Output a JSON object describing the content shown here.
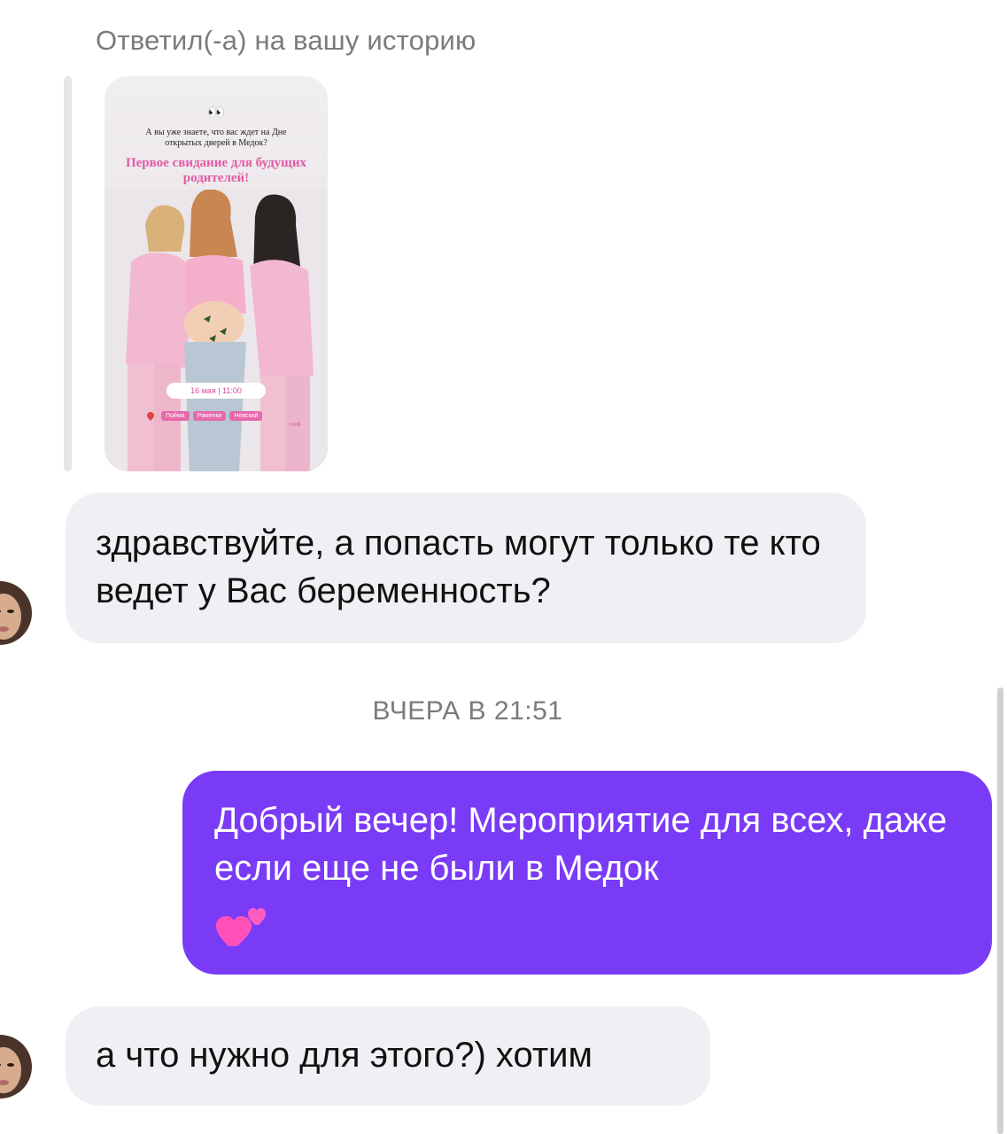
{
  "reply_header": "Ответил(-а) на вашу историю",
  "story": {
    "eyes_emoji": "👀",
    "teaser": "А вы уже знаете, что вас ждет на Дне открытых дверей в Медок?",
    "headline": "Первое свидание для будущих родителей!",
    "date": "16 мая | 11:00",
    "locations": [
      "Пойма",
      "Раменки",
      "Невский"
    ],
    "city": "+спб",
    "accent_color": "#e35aa6"
  },
  "messages": [
    {
      "direction": "incoming",
      "text": "здравствуйте, а попасть могут только те кто ведет у Вас беременность?"
    },
    {
      "direction": "outgoing",
      "text": "Добрый вечер! Мероприятие для всех, даже если еще не были в Медок",
      "emoji": "two-hearts-icon"
    },
    {
      "direction": "incoming",
      "text": "а что нужно для этого?) хотим"
    }
  ],
  "timestamp": "ВЧЕРА В 21:51",
  "colors": {
    "outgoing_bubble": "#7a3bf7",
    "incoming_bubble": "#eff0f3",
    "meta_text": "#7a7a80"
  }
}
